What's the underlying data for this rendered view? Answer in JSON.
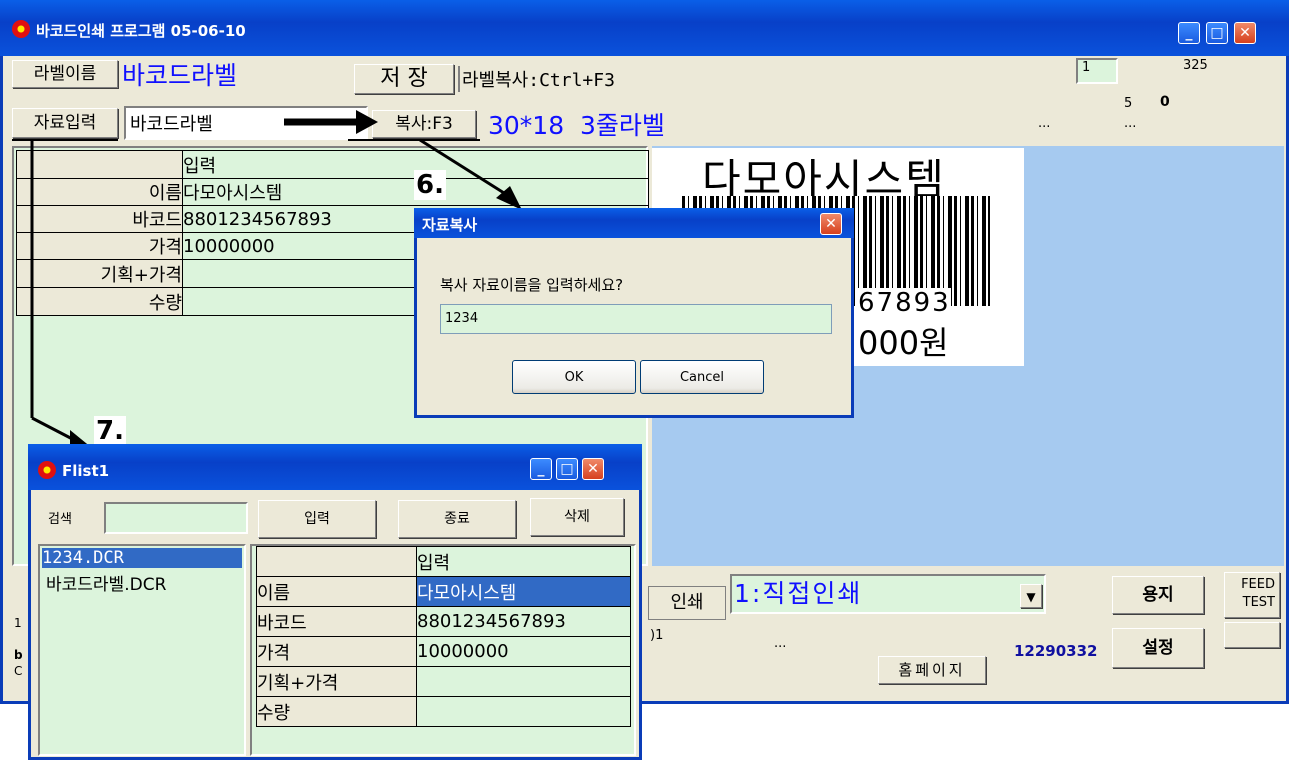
{
  "main_window": {
    "title": "바코드인쇄 프로그램 05-06-10",
    "label_name_btn": "라벨이름",
    "label_name_value": "바코드라벨",
    "save_btn": "저 장",
    "label_copy_hint": "라벨복사:Ctrl+F3",
    "top_right_input": "1",
    "top_right_num": "325",
    "num_5": "5",
    "num_0": "0",
    "dots_a": "...",
    "dots_b": "...",
    "data_input_btn": "자료입력",
    "data_input_value": "바코드라벨",
    "copy_f3": "복사:F3",
    "label_size": "30*18  3줄라벨",
    "grid": {
      "header": "입력",
      "rows": [
        {
          "label": "이름",
          "value": "다모아시스템"
        },
        {
          "label": "바코드",
          "value": "8801234567893"
        },
        {
          "label": "가격",
          "value": "10000000"
        },
        {
          "label": "기획+가격",
          "value": ""
        },
        {
          "label": "수량",
          "value": ""
        }
      ]
    },
    "preview": {
      "company": "다모아시스템",
      "barcode_digits": "67893",
      "price": "000원"
    },
    "print_btn": "인쇄",
    "print_mode": "1:직접인쇄",
    "paper_btn": "용지",
    "feed_test_btn_1": "FEED",
    "feed_test_btn_2": "TEST",
    "settings_btn": "설정",
    "serial": "12290332",
    "homepage_btn": "홈페이지",
    "bottom_dots": "...",
    "bottom_partial": ")1",
    "left_partial_1": "1",
    "left_partial_2": "b",
    "left_partial_3": "C"
  },
  "annotations": {
    "step6": "6.",
    "step7": "7."
  },
  "copy_dialog": {
    "title": "자료복사",
    "prompt": "복사 자료이름을 입력하세요?",
    "input_value": "1234",
    "ok": "OK",
    "cancel": "Cancel"
  },
  "flist_window": {
    "title": "Flist1",
    "search_label": "검색",
    "search_value": "",
    "input_btn": "입력",
    "close_btn": "종료",
    "delete_btn": "삭제",
    "files": [
      "1234.DCR",
      "바코드라벨.DCR"
    ],
    "grid": {
      "header": "입력",
      "rows": [
        {
          "label": "이름",
          "value": "다모아시스템"
        },
        {
          "label": "바코드",
          "value": "8801234567893"
        },
        {
          "label": "가격",
          "value": "10000000"
        },
        {
          "label": "기획+가격",
          "value": ""
        },
        {
          "label": "수량",
          "value": ""
        }
      ]
    }
  },
  "colors": {
    "xp_title": "#0a52dc",
    "panel": "#ece9d8",
    "grid_bg": "#dcf4dc",
    "preview_bg": "#a6caf0",
    "label_blue": "#1010ff"
  }
}
